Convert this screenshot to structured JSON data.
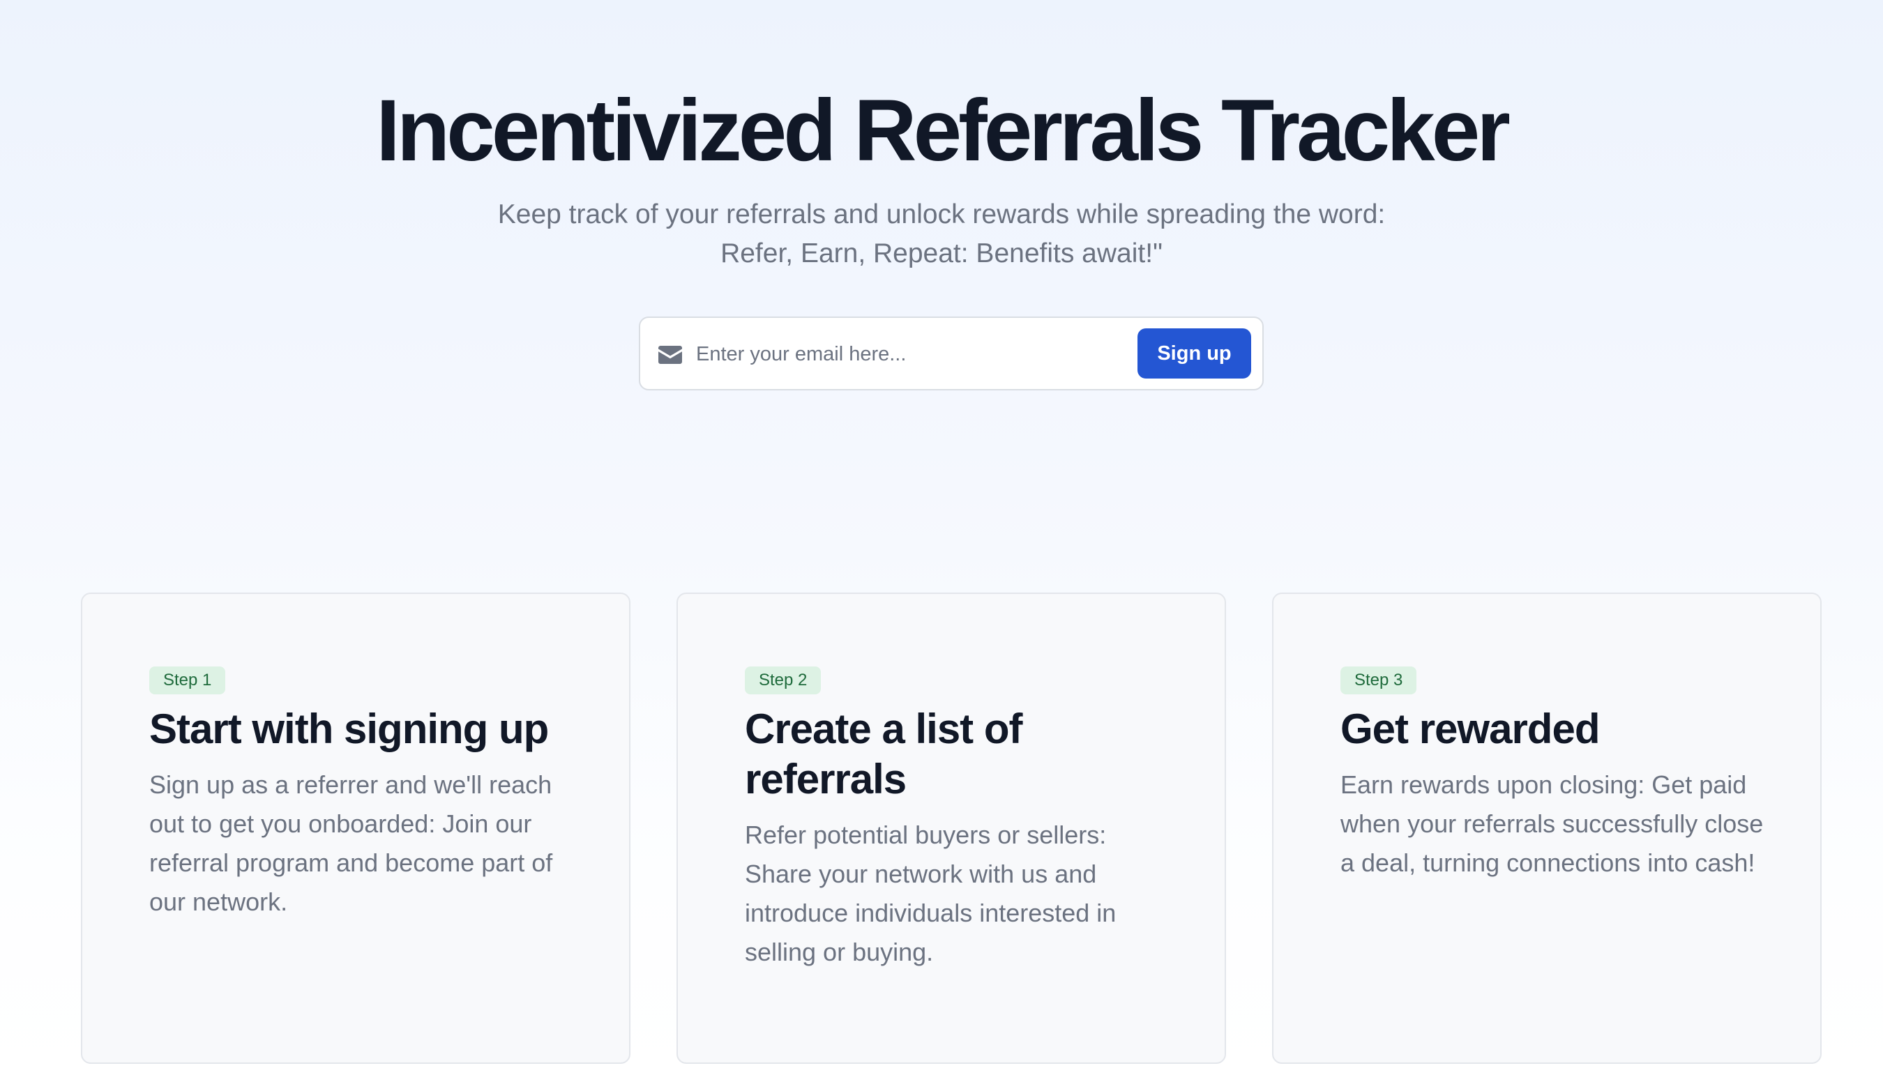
{
  "hero": {
    "title": "Incentivized Referrals Tracker",
    "subtitle_line1": "Keep track of your referrals and unlock rewards while spreading the word:",
    "subtitle_line2": "Refer, Earn, Repeat: Benefits await!\""
  },
  "signup": {
    "icon": "mail-icon",
    "placeholder": "Enter your email here...",
    "value": "",
    "button_label": "Sign up",
    "button_color": "#2456d3"
  },
  "steps": [
    {
      "badge": "Step 1",
      "title": "Start with signing up",
      "description": "Sign up as a referrer and we'll reach out to get you onboarded: Join our referral program and become part of our network."
    },
    {
      "badge": "Step 2",
      "title": "Create a list of referrals",
      "description": "Refer potential buyers or sellers: Share your network with us and introduce individuals interested in selling or buying."
    },
    {
      "badge": "Step 3",
      "title": "Get rewarded",
      "description": "Earn rewards upon closing: Get paid when your referrals successfully close a deal, turning connections into cash!"
    }
  ],
  "colors": {
    "title": "#111827",
    "muted_text": "#6b7280",
    "badge_background": "#ddf2e4",
    "badge_text": "#1f6b3c",
    "card_background": "#f8f9fb"
  }
}
